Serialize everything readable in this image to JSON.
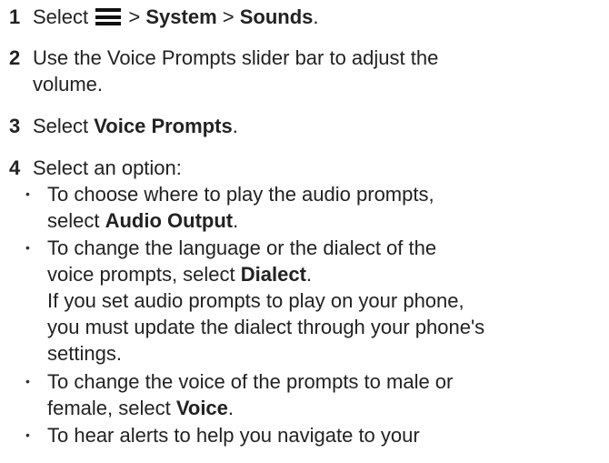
{
  "steps": [
    {
      "num": "1",
      "pre": "Select",
      "icon": "menu-icon",
      "sep1": " > ",
      "b1": "System",
      "sep2": " > ",
      "b2": "Sounds",
      "post": "."
    },
    {
      "num": "2",
      "line1": "Use the Voice Prompts slider bar to adjust the",
      "line2": "volume."
    },
    {
      "num": "3",
      "pre": "Select ",
      "b1": "Voice Prompts",
      "post": "."
    },
    {
      "num": "4",
      "text": "Select an option:"
    }
  ],
  "bullets": [
    {
      "line1": "To choose where to play the audio prompts,",
      "pre2": "select ",
      "b": "Audio Output",
      "post2": "."
    },
    {
      "line1": "To change the language or the dialect of the",
      "pre2": "voice prompts, select ",
      "b": "Dialect",
      "post2": ".",
      "note1": "If you set audio prompts to play on your phone,",
      "note2": "you must update the dialect through your phone's",
      "note3": "settings."
    },
    {
      "line1": "To change the voice of the prompts to male or",
      "pre2": "female, select ",
      "b": "Voice",
      "post2": "."
    },
    {
      "line1": "To hear alerts to help you navigate to your"
    }
  ],
  "bullet_glyph": "•"
}
